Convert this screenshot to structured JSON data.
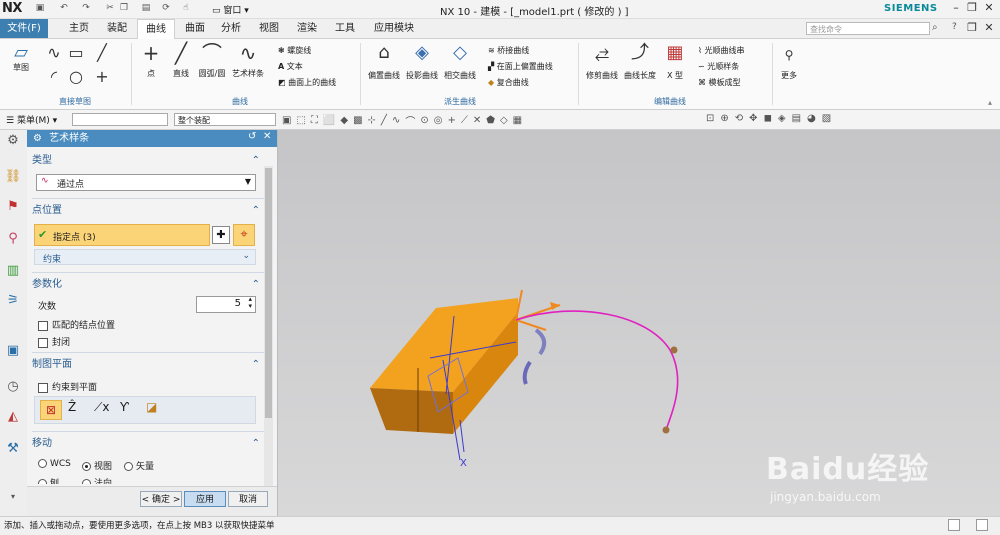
{
  "app": {
    "logo": "NX",
    "window_title": "NX 10 - 建模 - [_model1.prt  ( 修改的 ) ]",
    "brand": "SIEMENS",
    "window_menu": "窗口",
    "search_placeholder": "查找命令"
  },
  "menu_tabs": {
    "file": "文件(F)",
    "items": [
      "主页",
      "装配",
      "曲线",
      "曲面",
      "分析",
      "视图",
      "渲染",
      "工具",
      "应用模块"
    ],
    "active": "曲线"
  },
  "ribbon": {
    "sketch": "草图",
    "point": "点",
    "line": "直线",
    "arc": "圆弧/圆",
    "studio_spline": "艺术样条",
    "helix": "螺旋线",
    "text": "文本",
    "curve_on_surface": "曲面上的曲线",
    "offset_curve": "偏置曲线",
    "project_curve": "投影曲线",
    "intersect_curve": "相交曲线",
    "bridge_curve": "桥接曲线",
    "offset_in_face": "在面上偏置曲线",
    "composite_curve": "复合曲线",
    "trim_curve": "修剪曲线",
    "curve_length": "曲线长度",
    "x_form": "X 型",
    "smooth_spline_chain": "光顺曲线串",
    "smooth_spline": "光顺样条",
    "template_shape": "模板成型",
    "more": "更多",
    "groups": {
      "direct_sketch": "直接草图",
      "curve": "曲线",
      "derived_curve": "派生曲线",
      "edit_curve": "编辑曲线"
    }
  },
  "toolbar2": {
    "menu": "菜单(M)",
    "filter_value": "",
    "assembly_scope": "整个装配"
  },
  "dialog": {
    "title": "艺术样条",
    "type_section": "类型",
    "type_value": "通过点",
    "point_section": "点位置",
    "specify_point": "指定点 (3)",
    "constraint": "约束",
    "param_section": "参数化",
    "degree_label": "次数",
    "degree_value": "5",
    "match_knots": "匹配的结点位置",
    "closed": "封闭",
    "plane_section": "制图平面",
    "constrain_to_plane": "约束到平面",
    "move_section": "移动",
    "move_options": [
      "WCS",
      "视图",
      "矢量"
    ],
    "move_selected": "视图",
    "move_options_row2": [
      "刨",
      "法向"
    ],
    "ok": "< 确定 >",
    "apply": "应用",
    "cancel": "取消"
  },
  "viewport": {
    "axis_x": "X",
    "accent_block": "#f0a020",
    "spline_color": "#e020c0"
  },
  "status": {
    "text": "添加、插入或拖动点，要使用更多选项，在点上按 MB3 以获取快捷菜单"
  },
  "watermark": {
    "brand": "Baidu经验",
    "url": "jingyan.baidu.com"
  }
}
